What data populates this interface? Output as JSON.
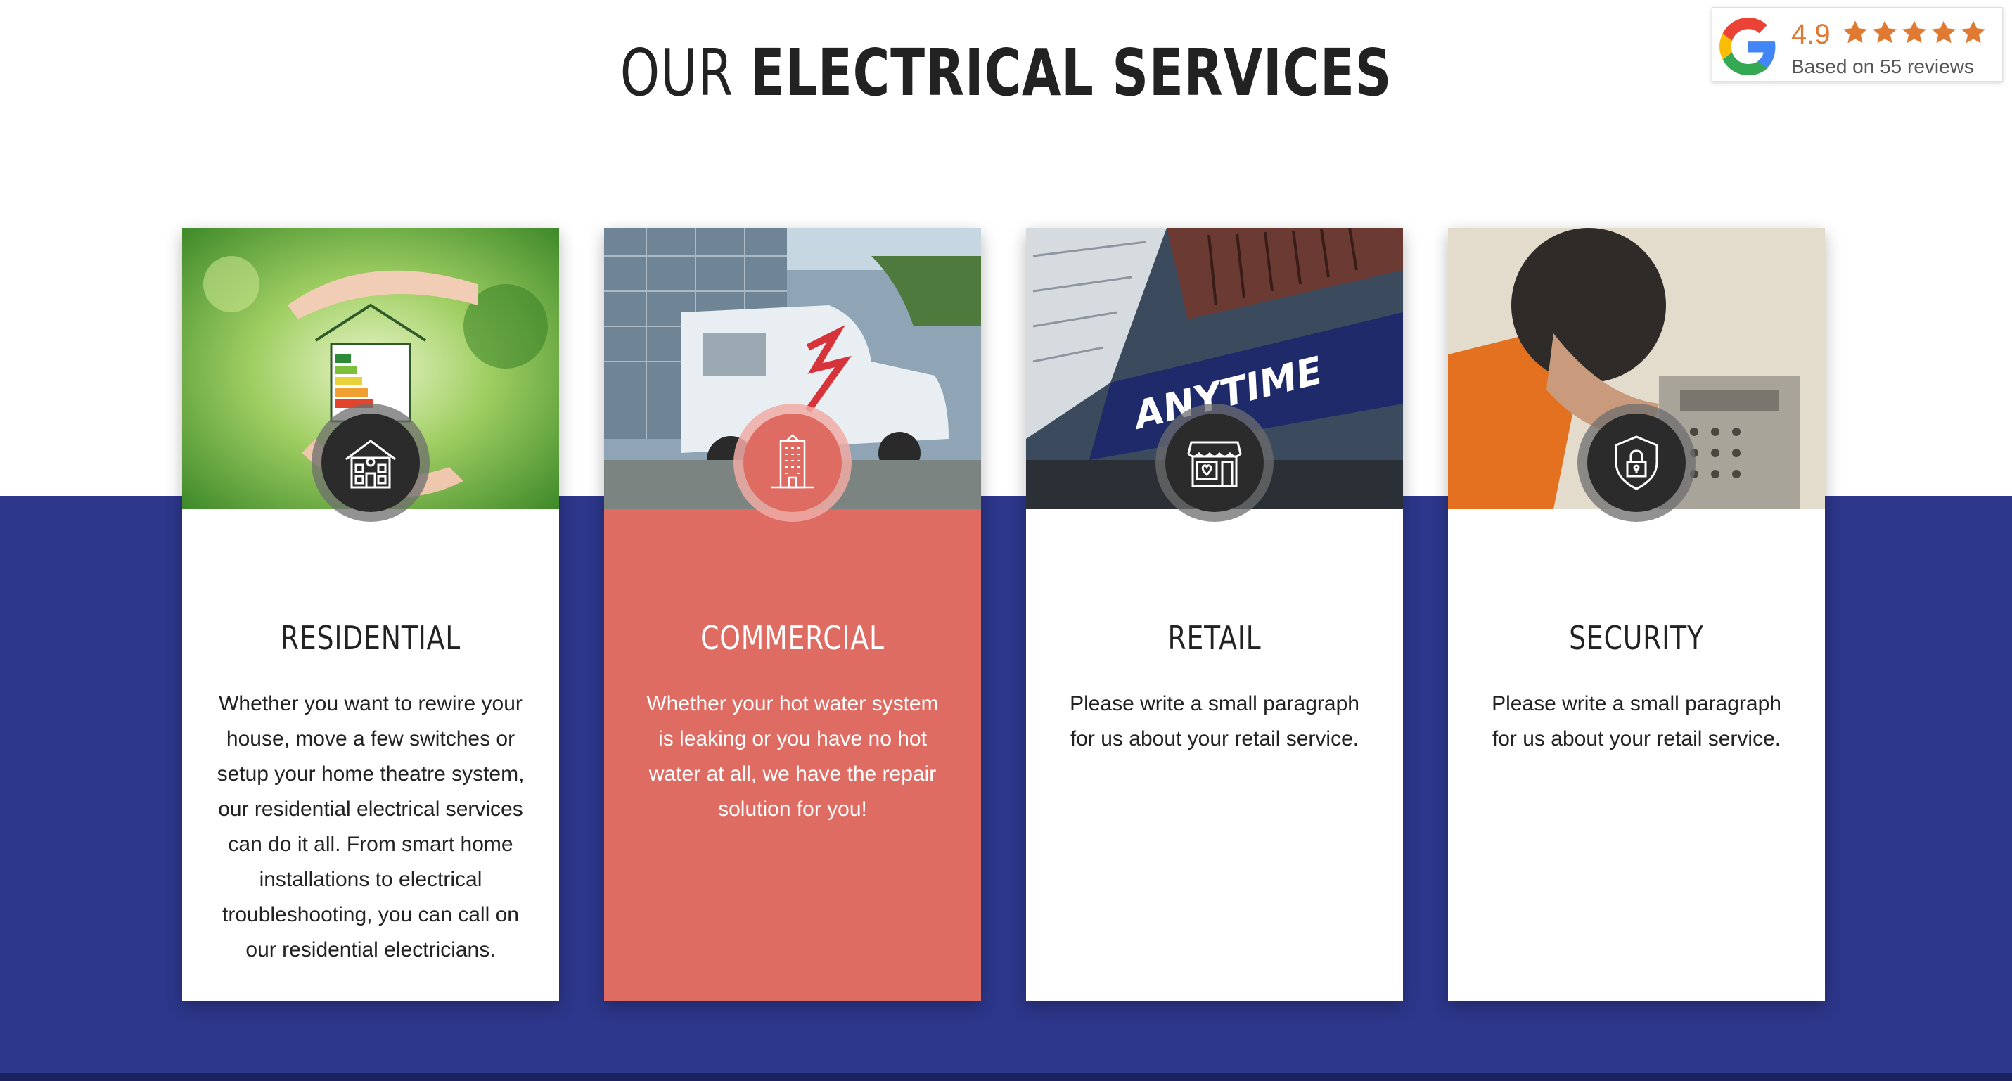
{
  "section": {
    "title_light": "OUR",
    "title_bold": "ELECTRICAL SERVICES"
  },
  "rating": {
    "score": "4.9",
    "stars": 5,
    "reviews_text": "Based on 55 reviews",
    "star_color": "#e07a32"
  },
  "cards": [
    {
      "title": "RESIDENTIAL",
      "icon": "house-icon",
      "text": "Whether you want to rewire your house, move a few switches or setup your home theatre system, our residential electrical services can do it all. From smart home installations to electrical troubleshooting, you can call on our residential electricians."
    },
    {
      "title": "COMMERCIAL",
      "icon": "building-icon",
      "text": "Whether your hot water system is leaking or you have no hot water at all, we have the repair solution for you!"
    },
    {
      "title": "RETAIL",
      "icon": "shop-icon",
      "text": "Please write a small paragraph for us about your retail service."
    },
    {
      "title": "SECURITY",
      "icon": "shield-lock-icon",
      "text": "Please write a small paragraph for us about your retail service."
    }
  ],
  "colors": {
    "band": "#2d378b",
    "active_card": "#df6c63"
  }
}
